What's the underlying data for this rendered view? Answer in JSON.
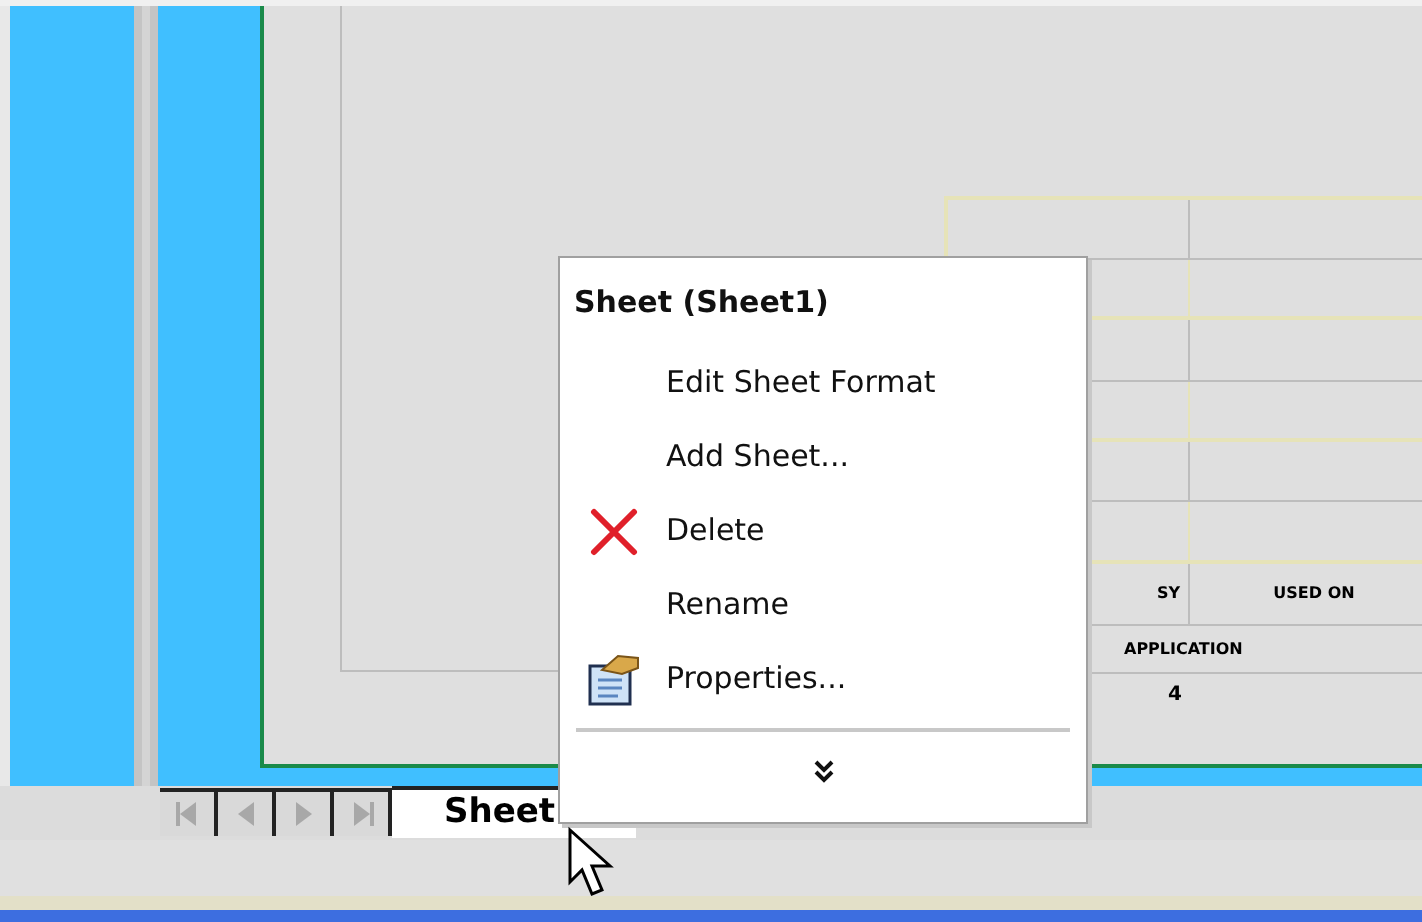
{
  "title_block": {
    "next_assy": "SY",
    "used_on": "USED ON",
    "application": "APPLICATION",
    "quantity": "4"
  },
  "tabs": [
    {
      "label": "Sheet",
      "selected": true
    }
  ],
  "menu": {
    "title": "Sheet (Sheet1)",
    "items": [
      {
        "label": "Edit Sheet Format",
        "kind": "plain"
      },
      {
        "label": "Add Sheet...",
        "kind": "plain"
      },
      {
        "label": "Delete",
        "kind": "delete"
      },
      {
        "label": "Rename",
        "kind": "plain"
      },
      {
        "label": "Properties...",
        "kind": "properties"
      }
    ]
  }
}
